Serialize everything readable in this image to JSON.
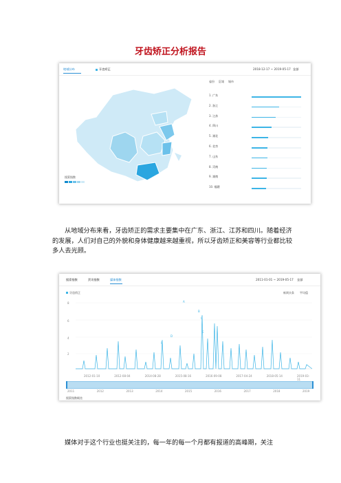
{
  "doc": {
    "title": "牙齿矫正分析报告",
    "para1": "从地域分布来看，牙齿矫正的需求主要集中在广东、浙江、江苏和四川。随着经济的发展，人们对自己的外貌和身体健康越来越重视，所以牙齿矫正和美容等行业都比较多人去光顾。",
    "para2": "媒体对于这个行业也挺关注的，每一年的每一个月都有报道的高峰期，关注"
  },
  "regional": {
    "tab_label": "地域分布",
    "legend_series": "牙齿矫正",
    "date_range": "2018-12-17 ~ 2019-05-17",
    "device": "全部",
    "sub_tabs": [
      "省份",
      "区域",
      "城市"
    ],
    "legend_title": "搜索指数",
    "ranking": [
      {
        "rank": "1.",
        "name": "广东",
        "value": 1.0
      },
      {
        "rank": "2.",
        "name": "浙江",
        "value": 0.55
      },
      {
        "rank": "3.",
        "name": "江苏",
        "value": 0.48
      },
      {
        "rank": "4.",
        "name": "四川",
        "value": 0.4
      },
      {
        "rank": "5.",
        "name": "湖北",
        "value": 0.33
      },
      {
        "rank": "6.",
        "name": "北京",
        "value": 0.32
      },
      {
        "rank": "7.",
        "name": "山东",
        "value": 0.32
      },
      {
        "rank": "8.",
        "name": "河南",
        "value": 0.31
      },
      {
        "rank": "9.",
        "name": "湖南",
        "value": 0.3
      },
      {
        "rank": "10.",
        "name": "福建",
        "value": 0.29
      }
    ]
  },
  "media": {
    "tabs": [
      "搜索指数",
      "资讯指数",
      "媒体指数"
    ],
    "legend_series": "牙齿矫正",
    "date_range": "2011-01-01 ~ 2019-05-17",
    "device": "全部",
    "options": [
      "新闻头条",
      "平均值"
    ],
    "overview_title": "搜索指数概览",
    "y_ticks": [
      "8",
      "6",
      "4",
      "2"
    ],
    "x_ticks": [
      "2012-01-10",
      "2012-08-04",
      "2014-08-28",
      "2015-08-16",
      "2016-09-08",
      "2017-04-24",
      "2018-05-14",
      "2019-03-11"
    ],
    "year_ticks": [
      "2011",
      "2012",
      "2013",
      "2014",
      "2015",
      "2016",
      "2017",
      "2018",
      "2019"
    ],
    "annotations": [
      "A",
      "B",
      "C",
      "D",
      "E",
      "F"
    ],
    "accent": "#3bb4e6"
  }
}
